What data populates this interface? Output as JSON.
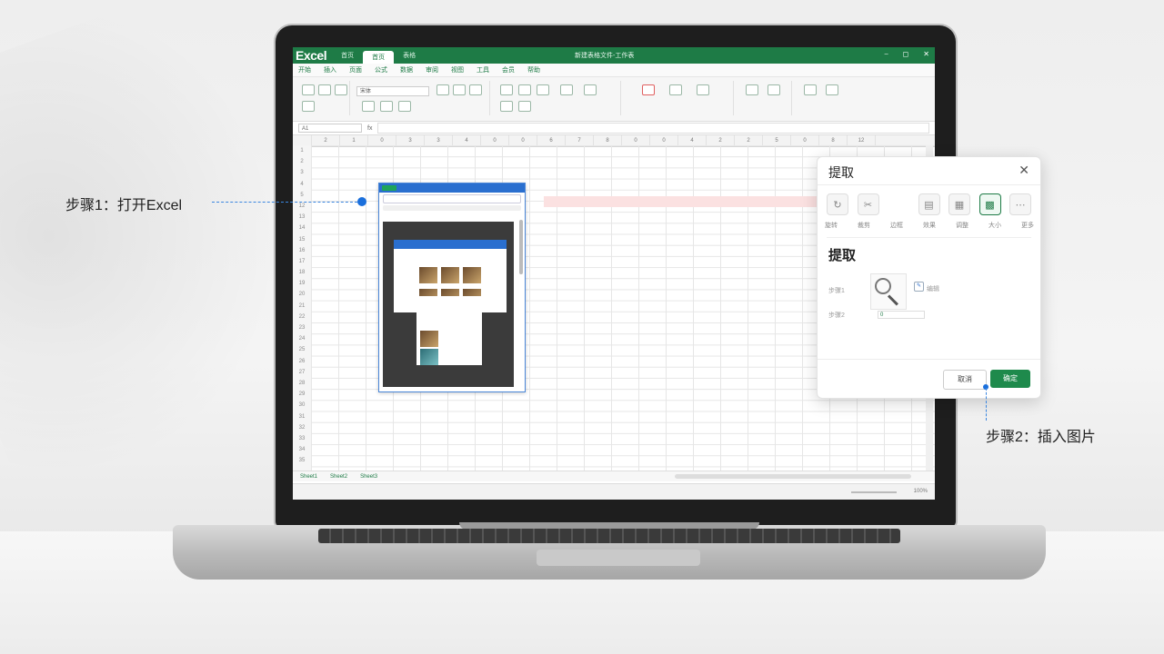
{
  "annotations": {
    "step1": "步骤1：打开Excel",
    "step2": "步骤2：插入图片"
  },
  "excel": {
    "logo": "Excel",
    "window_tabs": [
      "首页",
      "首页",
      "表格"
    ],
    "doc_title": "新建表格文件-工作表",
    "menu": [
      "开始",
      "插入",
      "页面",
      "公式",
      "数据",
      "审阅",
      "视图",
      "工具",
      "会员",
      "帮助"
    ],
    "font_name": "宋体",
    "name_box": "A1",
    "columns": [
      "2",
      "1",
      "0",
      "3",
      "3",
      "4",
      "0",
      "0",
      "6",
      "7",
      "8",
      "0",
      "0",
      "4",
      "2",
      "2",
      "5",
      "0",
      "8",
      "12"
    ],
    "rows": [
      "1",
      "2",
      "3",
      "4",
      "5",
      "12",
      "13",
      "14",
      "15",
      "16",
      "17",
      "18",
      "19",
      "20",
      "21",
      "22",
      "23",
      "24",
      "25",
      "26",
      "27",
      "28",
      "29",
      "30",
      "31",
      "32",
      "33",
      "34",
      "35"
    ],
    "sheet_tabs": [
      "Sheet1",
      "Sheet2",
      "Sheet3"
    ],
    "zoom": "100%",
    "inserted_picture_logo": "携程"
  },
  "dialog": {
    "title": "提取",
    "close_icon": "close-icon",
    "tools": [
      {
        "icon": "rotate-icon",
        "label": "旋转"
      },
      {
        "icon": "crop-icon",
        "label": "裁剪"
      },
      {
        "icon": "blank-icon",
        "label": "边框"
      },
      {
        "icon": "doc-icon",
        "label": "效果"
      },
      {
        "icon": "page-icon",
        "label": "调整"
      },
      {
        "icon": "image-icon",
        "label": "大小"
      },
      {
        "icon": "more-icon",
        "label": "更多"
      }
    ],
    "section_title": "提取",
    "label_source": "步骤1",
    "label_target": "步骤2",
    "edit_label": "编辑",
    "mini_value": "0",
    "cancel_label": "取消",
    "ok_label": "确定"
  }
}
